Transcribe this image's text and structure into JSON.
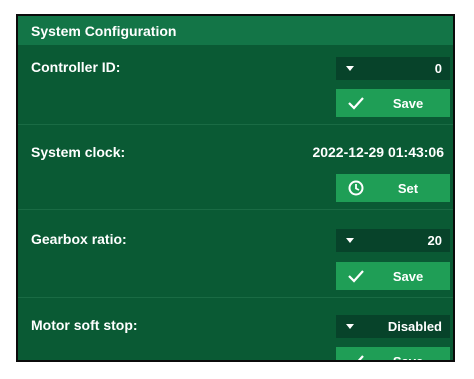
{
  "panel": {
    "title": "System Configuration"
  },
  "controller_id": {
    "label": "Controller ID:",
    "value": "0",
    "action_label": "Save",
    "action_icon": "check-icon"
  },
  "system_clock": {
    "label": "System clock:",
    "value": "2022-12-29 01:43:06",
    "action_label": "Set",
    "action_icon": "clock-icon"
  },
  "gearbox_ratio": {
    "label": "Gearbox ratio:",
    "value": "20",
    "action_label": "Save",
    "action_icon": "check-icon"
  },
  "motor_soft_stop": {
    "label": "Motor soft stop:",
    "value": "Disabled",
    "action_label": "Save",
    "action_icon": "check-icon"
  },
  "colors": {
    "panel_bg": "#0a5a34",
    "header_bg": "#137547",
    "button_bg": "#1f9e56",
    "dropdown_bg": "#07432a"
  }
}
